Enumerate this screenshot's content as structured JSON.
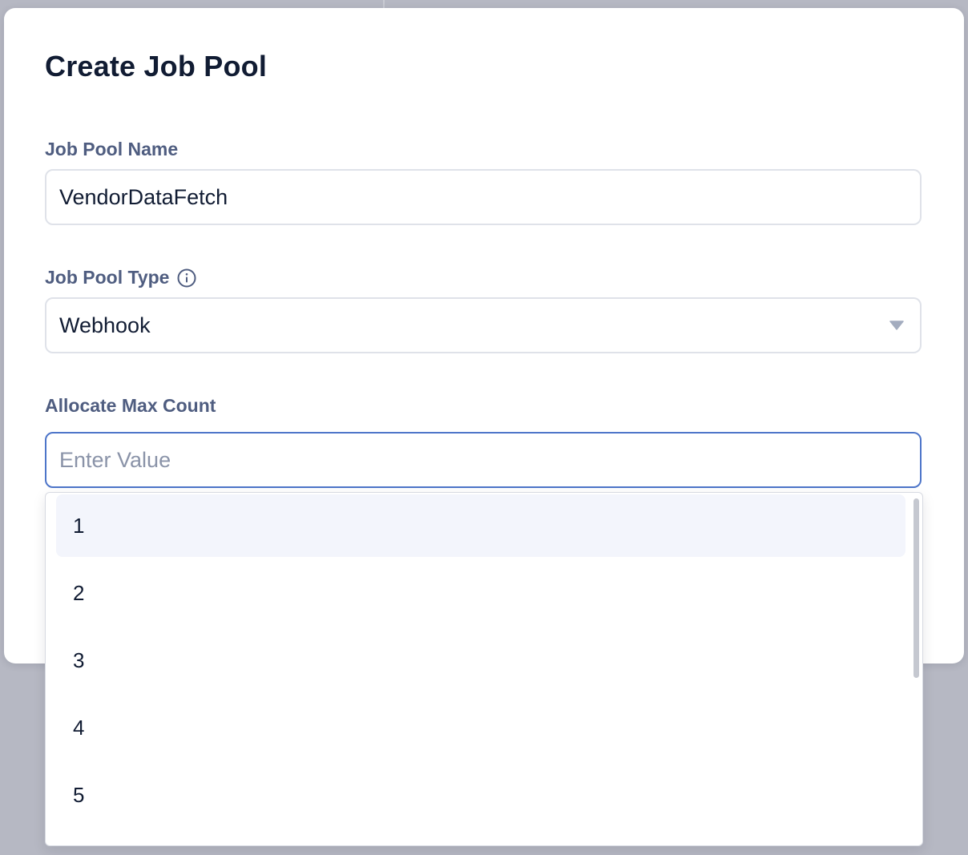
{
  "dialog": {
    "title": "Create Job Pool"
  },
  "fields": {
    "name": {
      "label": "Job Pool Name",
      "value": "VendorDataFetch"
    },
    "type": {
      "label": "Job Pool Type",
      "info_icon": "info-circle-icon",
      "value": "Webhook",
      "caret_icon": "caret-down-icon"
    },
    "max_count": {
      "label": "Allocate Max Count",
      "value": "",
      "placeholder": "Enter Value"
    }
  },
  "dropdown": {
    "options": [
      "1",
      "2",
      "3",
      "4",
      "5"
    ],
    "highlighted": "1"
  },
  "colors": {
    "title": "#111c33",
    "label": "#4f5d80",
    "focus_border": "#4d75c9",
    "highlight": "#f3f5fc",
    "backdrop": "#b6b8c3"
  }
}
